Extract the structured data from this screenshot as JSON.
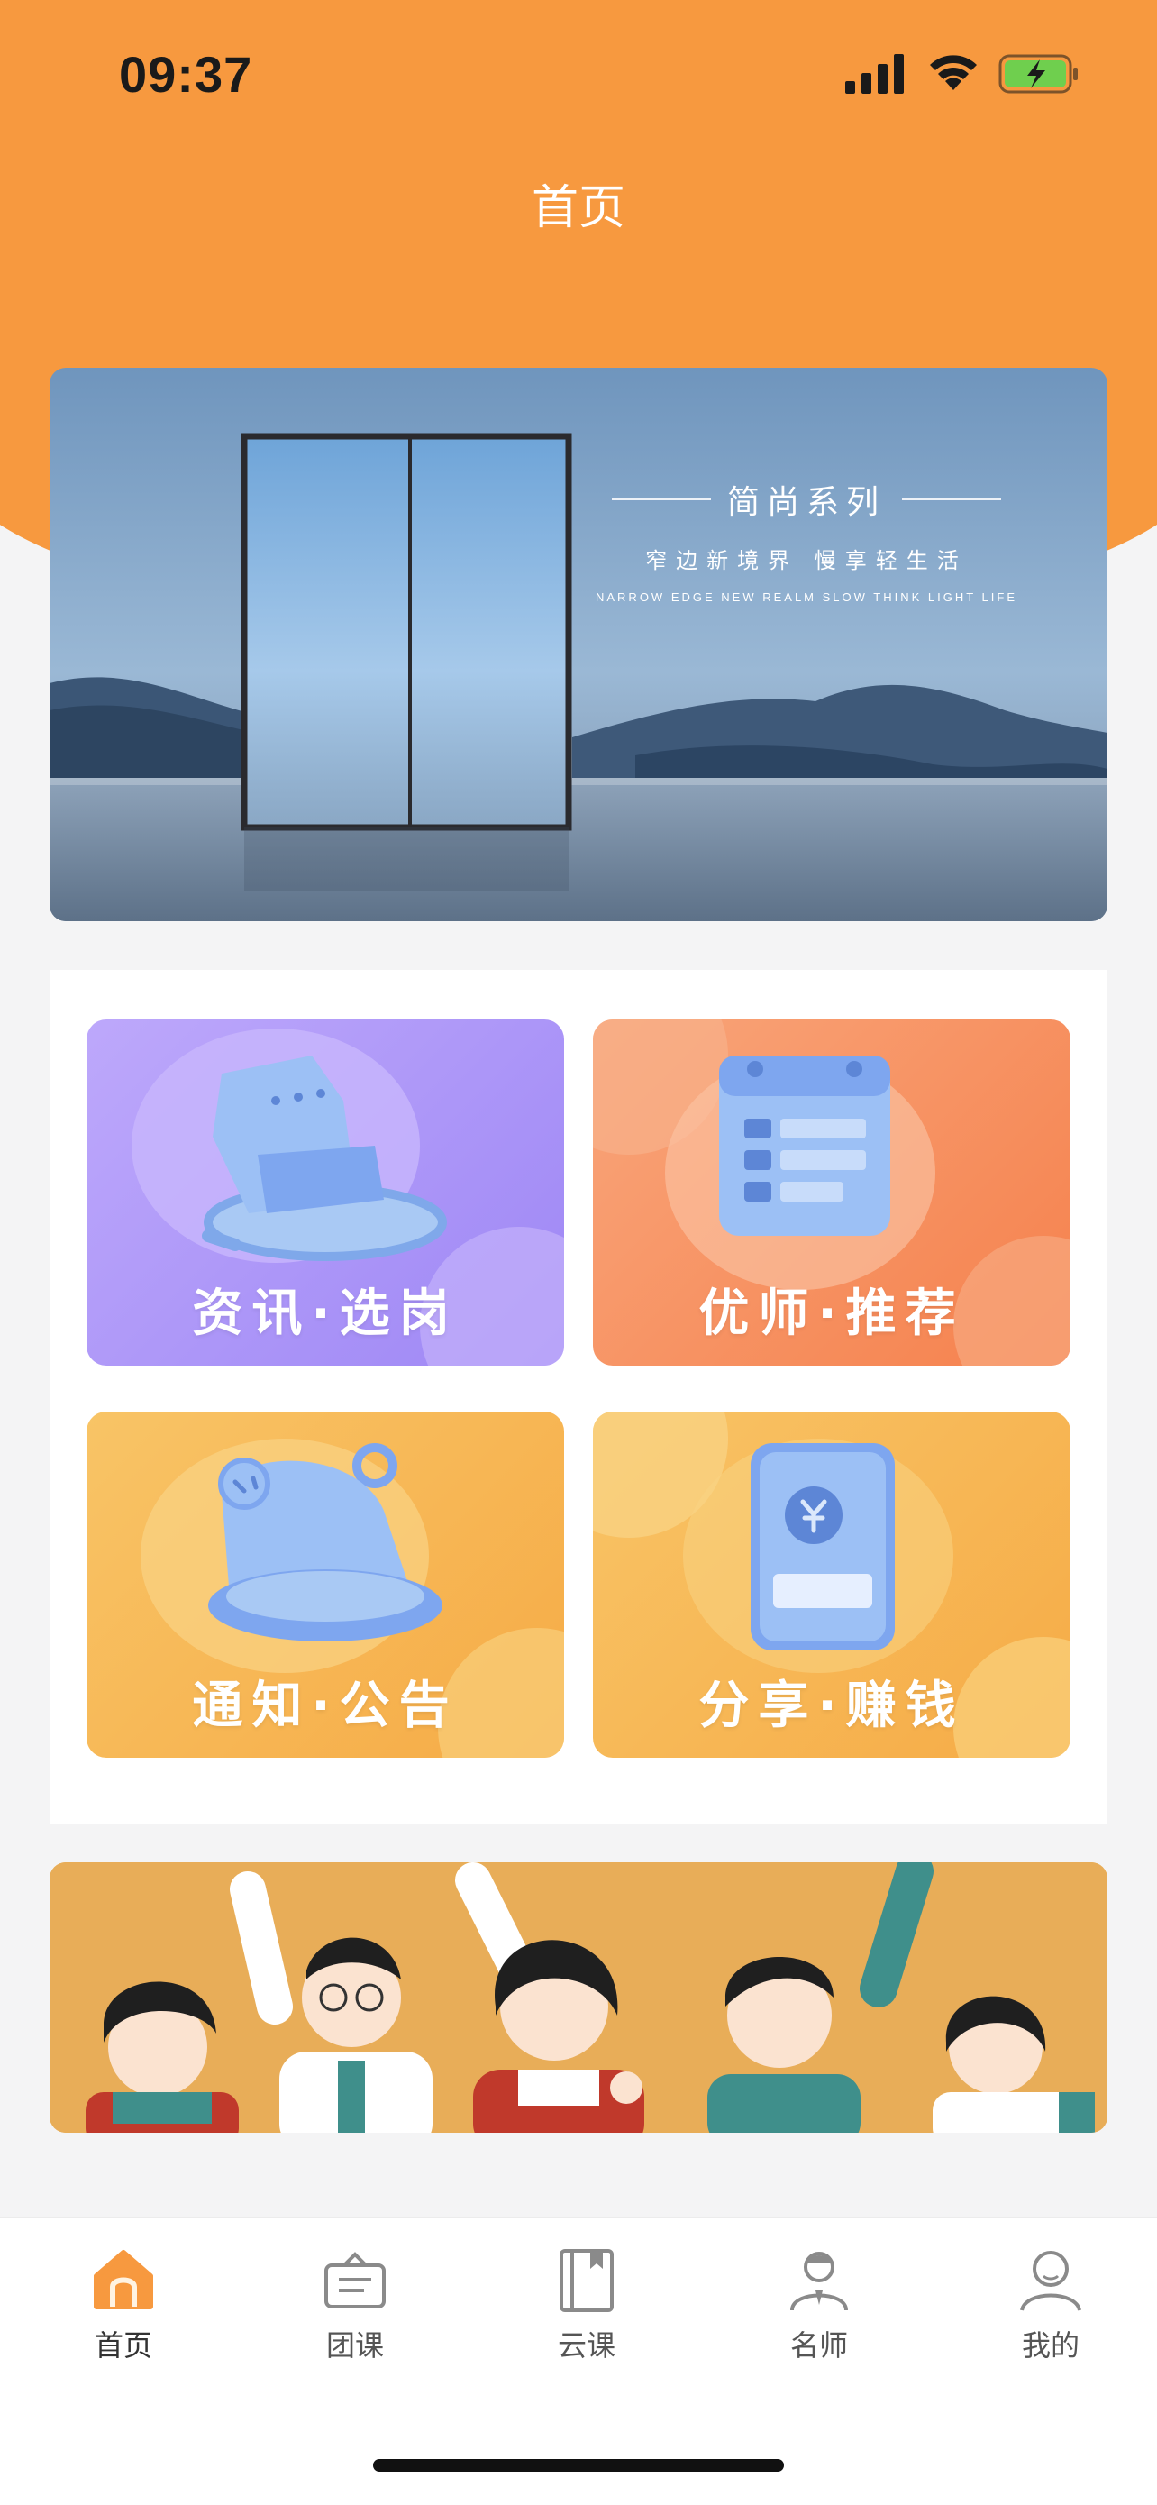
{
  "status_bar": {
    "time": "09:37"
  },
  "header": {
    "title": "首页"
  },
  "banner": {
    "title": "简尚系列",
    "subtitle": "窄边新境界  慢享轻生活",
    "english": "NARROW EDGE NEW REALM SLOW THINK LIGHT LIFE"
  },
  "menu": {
    "items": [
      {
        "label": "资讯·选岗",
        "icon": "chair-icon",
        "color_start": "#b9a2fb",
        "color_end": "#9d86f5"
      },
      {
        "label": "优师·推荐",
        "icon": "calendar-icon",
        "color_start": "#f9a274",
        "color_end": "#f6834f"
      },
      {
        "label": "通知·公告",
        "icon": "bell-icon",
        "color_start": "#f8c263",
        "color_end": "#f7ad4a"
      },
      {
        "label": "分享·赚钱",
        "icon": "phone-payment-icon",
        "color_start": "#f8c263",
        "color_end": "#f7ad4a"
      }
    ]
  },
  "tabbar": {
    "items": [
      {
        "label": "首页",
        "icon": "home-icon",
        "active": true
      },
      {
        "label": "团课",
        "icon": "class-icon",
        "active": false
      },
      {
        "label": "云课",
        "icon": "book-icon",
        "active": false
      },
      {
        "label": "名师",
        "icon": "teacher-icon",
        "active": false
      },
      {
        "label": "我的",
        "icon": "profile-icon",
        "active": false
      }
    ]
  },
  "colors": {
    "accent": "#f7993f",
    "background": "#f4f4f5"
  }
}
